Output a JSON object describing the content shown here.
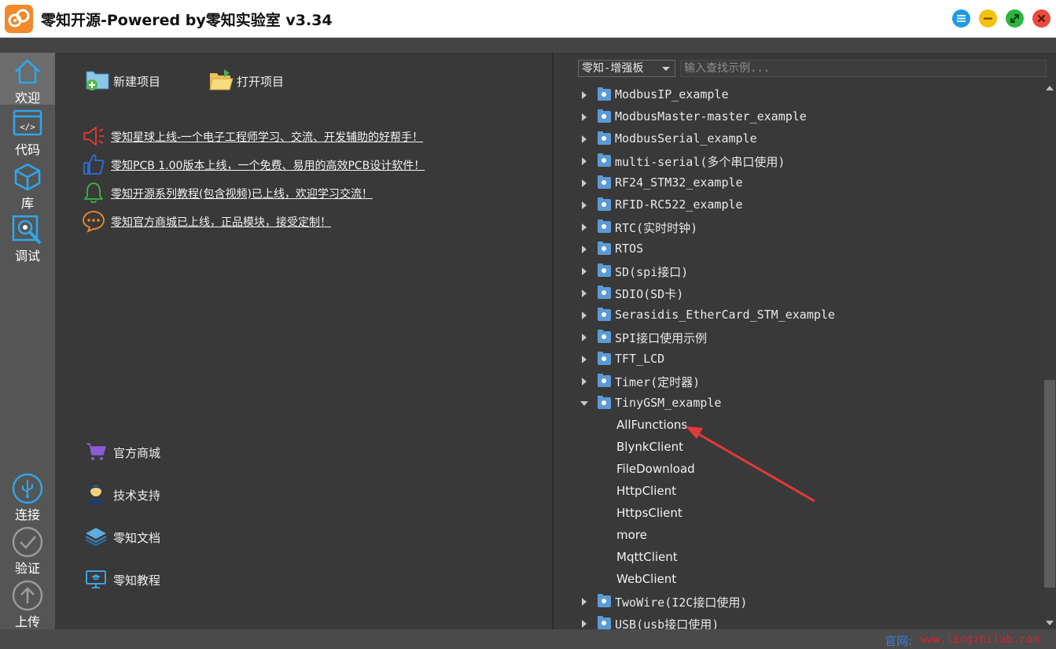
{
  "window": {
    "title": "零知开源-Powered by零知实验室 v3.34",
    "logo_icon": "lingzhi-logo-icon",
    "controls": [
      "menu-icon",
      "minimize-icon",
      "maximize-icon",
      "close-icon"
    ]
  },
  "nav": {
    "items": [
      {
        "label": "欢迎",
        "icon": "home-icon",
        "active": true
      },
      {
        "label": "代码",
        "icon": "code-icon",
        "active": false
      },
      {
        "label": "库",
        "icon": "cube-icon",
        "active": false
      },
      {
        "label": "调试",
        "icon": "debug-icon",
        "active": false
      },
      {
        "label": "连接",
        "icon": "usb-icon",
        "active": false
      },
      {
        "label": "验证",
        "icon": "check-icon",
        "active": false
      },
      {
        "label": "上传",
        "icon": "upload-arrow-icon",
        "active": false
      }
    ]
  },
  "welcome": {
    "new_project": "新建项目",
    "open_project": "打开项目",
    "news": [
      {
        "text": "零知星球上线-一个电子工程师学习、交流、开发辅助的好帮手！",
        "icon": "megaphone-icon"
      },
      {
        "text": "零知PCB 1.00版本上线，一个免费、易用的高效PCB设计软件！",
        "icon": "thumbs-up-icon"
      },
      {
        "text": "零知开源系列教程(包含视频)已上线，欢迎学习交流！",
        "icon": "bell-icon"
      },
      {
        "text": "零知官方商城已上线，正品模块，接受定制！",
        "icon": "chat-bubble-icon"
      }
    ],
    "links": [
      {
        "label": "官方商城",
        "icon": "shopping-cart-icon"
      },
      {
        "label": "技术支持",
        "icon": "support-person-icon"
      },
      {
        "label": "零知文档",
        "icon": "layers-icon"
      },
      {
        "label": "零知教程",
        "icon": "monitor-tutorial-icon"
      }
    ]
  },
  "examples": {
    "board_select": "零知-增强板",
    "search_placeholder": "输入查找示例...",
    "tree": [
      {
        "label": "ModbusIP_example",
        "expanded": false
      },
      {
        "label": "ModbusMaster-master_example",
        "expanded": false
      },
      {
        "label": "ModbusSerial_example",
        "expanded": false
      },
      {
        "label": "multi-serial(多个串口使用)",
        "expanded": false
      },
      {
        "label": "RF24_STM32_example",
        "expanded": false
      },
      {
        "label": "RFID-RC522_example",
        "expanded": false
      },
      {
        "label": "RTC(实时时钟)",
        "expanded": false
      },
      {
        "label": "RTOS",
        "expanded": false
      },
      {
        "label": "SD(spi接口)",
        "expanded": false
      },
      {
        "label": "SDIO(SD卡)",
        "expanded": false
      },
      {
        "label": "Serasidis_EtherCard_STM_example",
        "expanded": false
      },
      {
        "label": "SPI接口使用示例",
        "expanded": false
      },
      {
        "label": "TFT_LCD",
        "expanded": false
      },
      {
        "label": "Timer(定时器)",
        "expanded": false
      },
      {
        "label": "TinyGSM_example",
        "expanded": true,
        "children": [
          "AllFunctions",
          "BlynkClient",
          "FileDownload",
          "HttpClient",
          "HttpsClient",
          "more",
          "MqttClient",
          "WebClient"
        ]
      },
      {
        "label": "TwoWire(I2C接口使用)",
        "expanded": false
      },
      {
        "label": "USB(usb接口使用)",
        "expanded": false
      }
    ]
  },
  "status": {
    "website_label": "官网:",
    "website_url": "www.lingzhilab.com"
  },
  "colors": {
    "accent_blue": "#1e9be4",
    "annotation_red": "#e03a3a"
  }
}
